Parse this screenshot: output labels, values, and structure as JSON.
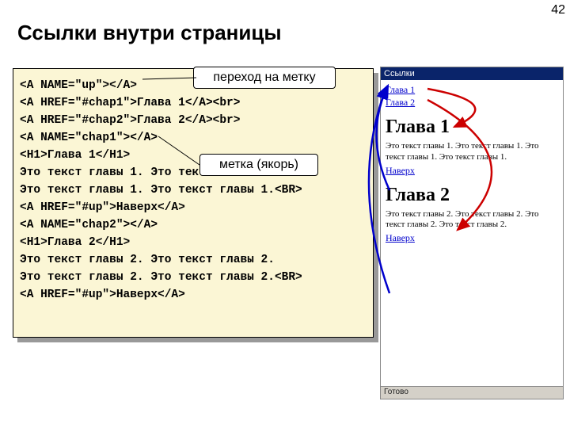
{
  "slide_number": "42",
  "title": "Ссылки внутри страницы",
  "callout1": "переход на метку",
  "callout2": "метка (якорь)",
  "code": {
    "l1": "<A NAME=\"up\"></A>",
    "l2": "<A HREF=\"#chap1\">Глава 1</A><br>",
    "l3": "<A HREF=\"#chap2\">Глава 2</A><br>",
    "l4": "<A NAME=\"chap1\"></A>",
    "l5": "<H1>Глава 1</H1>",
    "l6": "Это текст главы 1. Это текст главы 1.",
    "l7": "Это текст главы 1. Это текст главы 1.<BR>",
    "l8": "<A HREF=\"#up\">Наверх</A>",
    "l9": "<A NAME=\"chap2\"></A>",
    "l10": "<H1>Глава 2</H1>",
    "l11": "Это текст главы 2. Это текст главы 2.",
    "l12": "Это текст главы 2. Это текст главы 2.<BR>",
    "l13": "<A HREF=\"#up\">Наверх</A>"
  },
  "browser": {
    "title": "Ссылки",
    "link1": "Глава 1",
    "link2": "Глава 2",
    "h1a": "Глава 1",
    "p1": "Это текст главы 1. Это текст главы 1. Это текст главы 1. Это текст главы 1.",
    "up1": "Наверх",
    "h1b": "Глава 2",
    "p2": "Это текст главы 2. Это текст главы 2. Это текст главы 2. Это текст главы 2.",
    "up2": "Наверх",
    "status": "Готово"
  }
}
